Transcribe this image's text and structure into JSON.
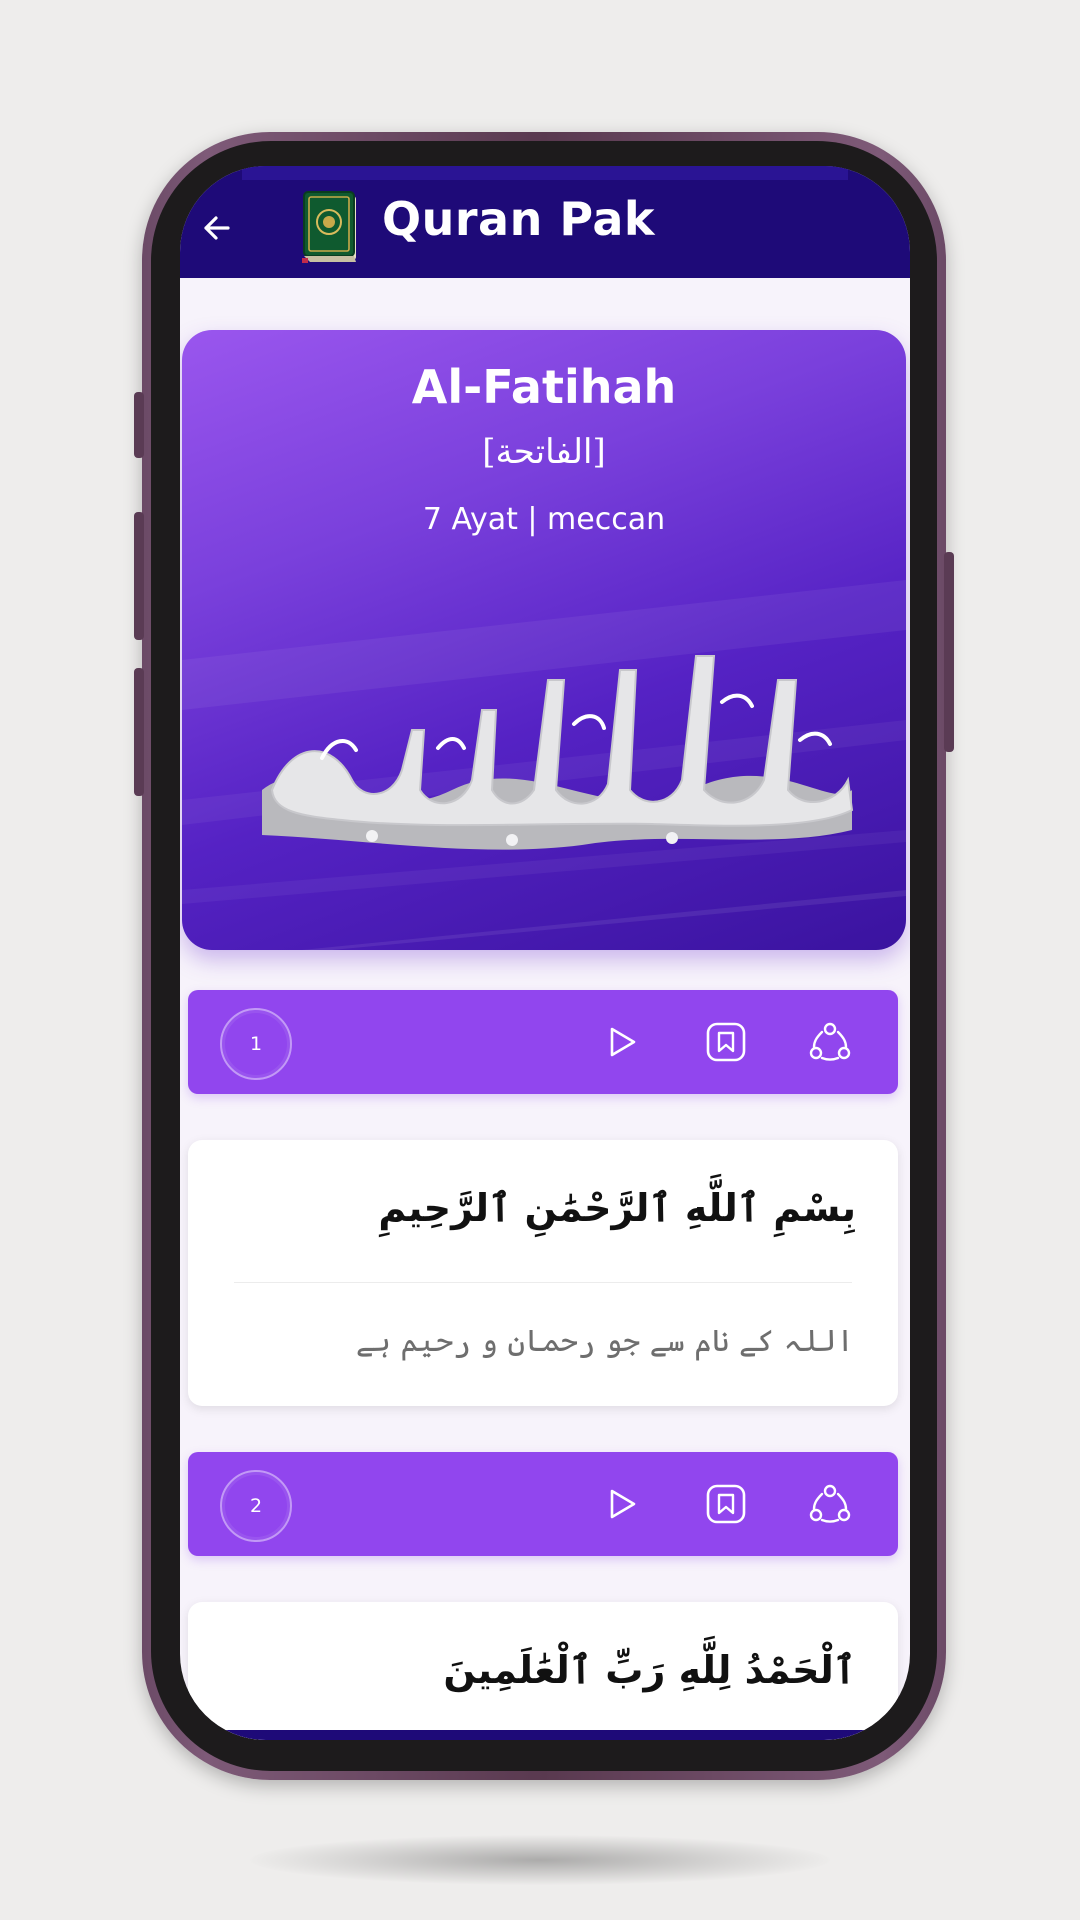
{
  "app": {
    "title": "Quran Pak",
    "back_icon": "arrow-left-icon",
    "logo_icon": "quran-book-icon"
  },
  "surah": {
    "name": "Al-Fatihah",
    "arabic_name": "[الفاتحة]",
    "meta": "7 Ayat | meccan",
    "bismillah_art": "بسم الله الرحمن الرحيم"
  },
  "ayahs": [
    {
      "number": "1",
      "arabic": "بِسْمِ ٱللَّهِ ٱلرَّحْمَٰنِ ٱلرَّحِيمِ",
      "translation": "اللہ کے نام سے جو رحمان و رحیم ہے"
    },
    {
      "number": "2",
      "arabic": "ٱلْحَمْدُ لِلَّهِ رَبِّ ٱلْعَٰلَمِينَ",
      "translation": ""
    }
  ],
  "icons": {
    "play": "play-icon",
    "bookmark": "bookmark-icon",
    "share": "share-icon"
  },
  "colors": {
    "appbar": "#1e0a78",
    "ayah_bar": "#9146ee",
    "hero_start": "#9a56ee",
    "hero_end": "#3a139f",
    "phone_frame": "#6b4a66"
  }
}
